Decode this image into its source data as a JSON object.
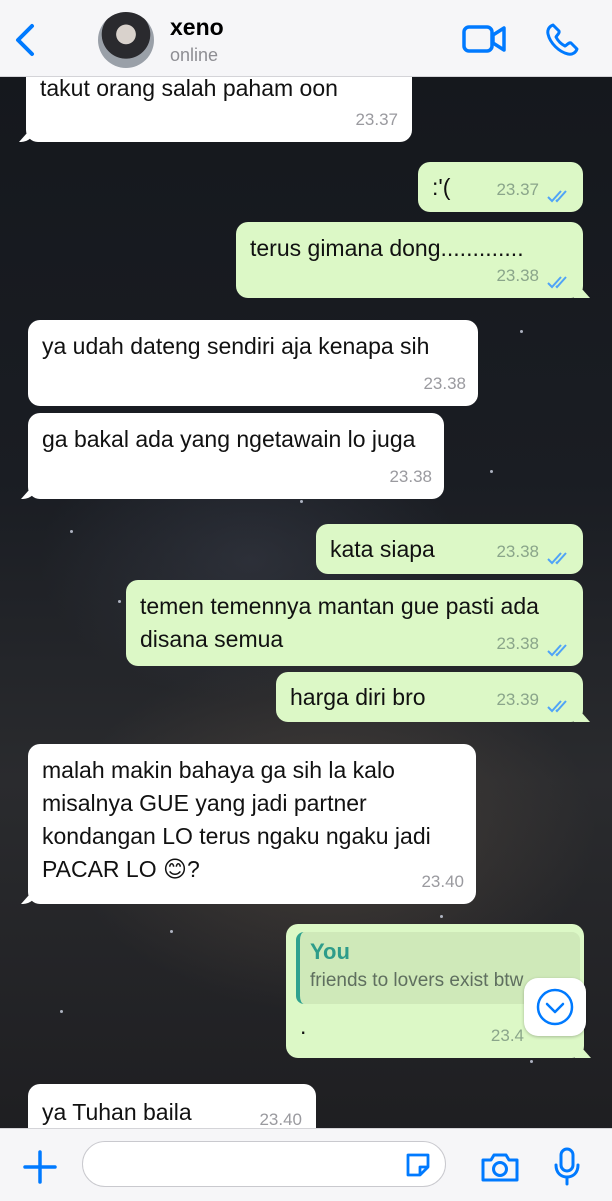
{
  "header": {
    "back_icon": "chevron-left-icon",
    "contact_name": "xeno",
    "status": "online",
    "video_icon": "video-camera-icon",
    "phone_icon": "phone-icon",
    "accent": "#007aff"
  },
  "messages": [
    {
      "dir": "in",
      "text": "takut orang salah paham oon",
      "time": "23.37"
    },
    {
      "dir": "out",
      "text": ":'(",
      "time": "23.37",
      "read": true
    },
    {
      "dir": "out",
      "text": "terus gimana dong.............",
      "time": "23.38",
      "read": true
    },
    {
      "dir": "in",
      "text": "ya udah dateng sendiri aja kenapa sih",
      "time": "23.38"
    },
    {
      "dir": "in",
      "text": "ga bakal ada yang ngetawain lo juga",
      "time": "23.38"
    },
    {
      "dir": "out",
      "text": "kata siapa",
      "time": "23.38",
      "read": true
    },
    {
      "dir": "out",
      "text": "temen temennya mantan gue pasti ada disana semua",
      "time": "23.38",
      "read": true
    },
    {
      "dir": "out",
      "text": "harga diri bro",
      "time": "23.39",
      "read": true
    },
    {
      "dir": "in",
      "text": "malah makin bahaya ga sih la kalo misalnya GUE yang jadi partner kondangan LO terus ngaku ngaku jadi PACAR LO 😊?",
      "time": "23.40"
    },
    {
      "dir": "out",
      "quote_author": "You",
      "quote_text": "friends to lovers exist btw",
      "text": ".",
      "time": "23.4"
    },
    {
      "dir": "in",
      "text": "ya Tuhan baila",
      "time": "23.40"
    }
  ],
  "scroll_down_icon": "chevron-down-circle-icon",
  "input_bar": {
    "plus_icon": "plus-icon",
    "message_value": "",
    "sticker_icon": "sticker-icon",
    "camera_icon": "camera-icon",
    "mic_icon": "microphone-icon"
  },
  "colors": {
    "outgoing_bubble": "#dcf8c6",
    "incoming_bubble": "#ffffff",
    "read_checks": "#4fa3f7",
    "quote_accent": "#2fa28f"
  }
}
